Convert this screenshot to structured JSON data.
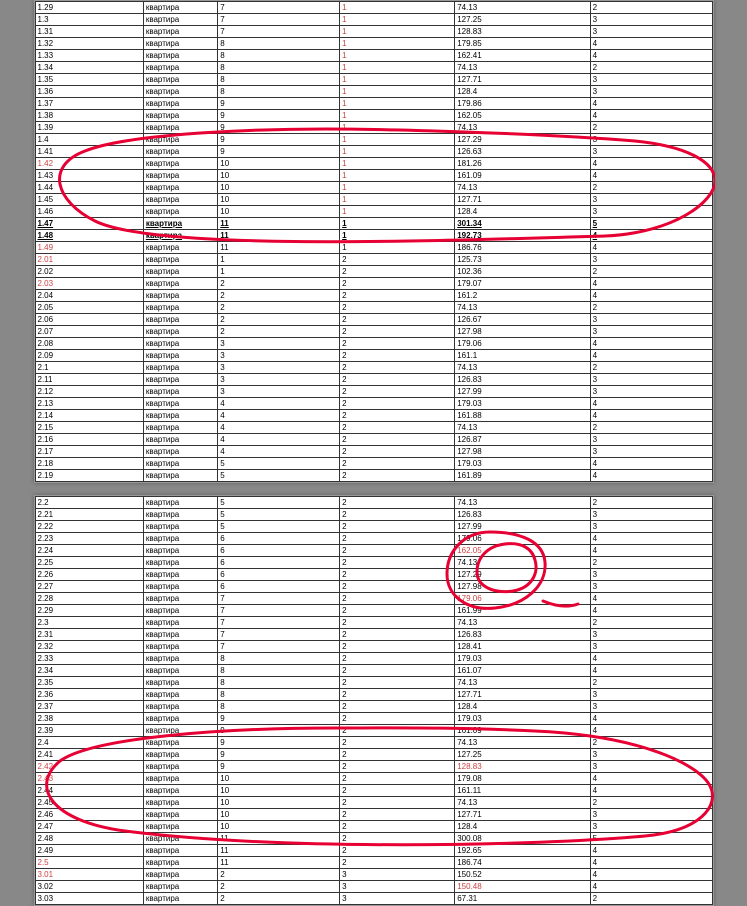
{
  "table1": {
    "rows": [
      {
        "id": "1.29",
        "type": "квартира",
        "a": "7",
        "b": "1",
        "area": "74.13",
        "r": "2",
        "bold": false,
        "bRed": true
      },
      {
        "id": "1.3",
        "type": "квартира",
        "a": "7",
        "b": "1",
        "area": "127.25",
        "r": "3",
        "bold": false,
        "bRed": true
      },
      {
        "id": "1.31",
        "type": "квартира",
        "a": "7",
        "b": "1",
        "area": "128.83",
        "r": "3",
        "bold": false,
        "bRed": true
      },
      {
        "id": "1.32",
        "type": "квартира",
        "a": "8",
        "b": "1",
        "area": "179.85",
        "r": "4",
        "bold": false,
        "bRed": true
      },
      {
        "id": "1.33",
        "type": "квартира",
        "a": "8",
        "b": "1",
        "area": "162.41",
        "r": "4",
        "bold": false,
        "bRed": true
      },
      {
        "id": "1.34",
        "type": "квартира",
        "a": "8",
        "b": "1",
        "area": "74.13",
        "r": "2",
        "bold": false,
        "bRed": true
      },
      {
        "id": "1.35",
        "type": "квартира",
        "a": "8",
        "b": "1",
        "area": "127.71",
        "r": "3",
        "bold": false,
        "bRed": true
      },
      {
        "id": "1.36",
        "type": "квартира",
        "a": "8",
        "b": "1",
        "area": "128.4",
        "r": "3",
        "bold": false,
        "bRed": true
      },
      {
        "id": "1.37",
        "type": "квартира",
        "a": "9",
        "b": "1",
        "area": "179.86",
        "r": "4",
        "bold": false,
        "bRed": true
      },
      {
        "id": "1.38",
        "type": "квартира",
        "a": "9",
        "b": "1",
        "area": "162.05",
        "r": "4",
        "bold": false,
        "bRed": true
      },
      {
        "id": "1.39",
        "type": "квартира",
        "a": "9",
        "b": "1",
        "area": "74.13",
        "r": "2",
        "bold": false,
        "bRed": true
      },
      {
        "id": "1.4",
        "type": "квартира",
        "a": "9",
        "b": "1",
        "area": "127.29",
        "r": "3",
        "bold": false,
        "bRed": true
      },
      {
        "id": "1.41",
        "type": "квартира",
        "a": "9",
        "b": "1",
        "area": "126.63",
        "r": "3",
        "bold": false,
        "bRed": true
      },
      {
        "id": "1.42",
        "type": "квартира",
        "a": "10",
        "b": "1",
        "area": "181.26",
        "r": "4",
        "bold": false,
        "bRed": true,
        "idRed": true
      },
      {
        "id": "1.43",
        "type": "квартира",
        "a": "10",
        "b": "1",
        "area": "161.09",
        "r": "4",
        "bold": false,
        "bRed": true
      },
      {
        "id": "1.44",
        "type": "квартира",
        "a": "10",
        "b": "1",
        "area": "74.13",
        "r": "2",
        "bold": false,
        "bRed": true
      },
      {
        "id": "1.45",
        "type": "квартира",
        "a": "10",
        "b": "1",
        "area": "127.71",
        "r": "3",
        "bold": false,
        "bRed": true
      },
      {
        "id": "1.46",
        "type": "квартира",
        "a": "10",
        "b": "1",
        "area": "128.4",
        "r": "3",
        "bold": false,
        "bRed": true
      },
      {
        "id": "1.47",
        "type": "квартира",
        "a": "11",
        "b": "1",
        "area": "301.34",
        "r": "5",
        "bold": true,
        "bRed": false
      },
      {
        "id": "1.48",
        "type": "квартира",
        "a": "11",
        "b": "1",
        "area": "192.73",
        "r": "4",
        "bold": true,
        "bRed": false
      },
      {
        "id": "1.49",
        "type": "квартира",
        "a": "11",
        "b": "1",
        "area": "186.76",
        "r": "4",
        "bold": false,
        "bRed": false,
        "idRed": true
      },
      {
        "id": "2.01",
        "type": "квартира",
        "a": "1",
        "b": "2",
        "area": "125.73",
        "r": "3",
        "bold": false,
        "bRed": false,
        "idRed": true
      },
      {
        "id": "2.02",
        "type": "квартира",
        "a": "1",
        "b": "2",
        "area": "102.36",
        "r": "2",
        "bold": false,
        "bRed": false
      },
      {
        "id": "2.03",
        "type": "квартира",
        "a": "2",
        "b": "2",
        "area": "179.07",
        "r": "4",
        "bold": false,
        "bRed": false,
        "idRed": true
      },
      {
        "id": "2.04",
        "type": "квартира",
        "a": "2",
        "b": "2",
        "area": "161.2",
        "r": "4",
        "bold": false,
        "bRed": false
      },
      {
        "id": "2.05",
        "type": "квартира",
        "a": "2",
        "b": "2",
        "area": "74.13",
        "r": "2",
        "bold": false,
        "bRed": false
      },
      {
        "id": "2.06",
        "type": "квартира",
        "a": "2",
        "b": "2",
        "area": "126.67",
        "r": "3",
        "bold": false,
        "bRed": false
      },
      {
        "id": "2.07",
        "type": "квартира",
        "a": "2",
        "b": "2",
        "area": "127.98",
        "r": "3",
        "bold": false,
        "bRed": false
      },
      {
        "id": "2.08",
        "type": "квартира",
        "a": "3",
        "b": "2",
        "area": "179.06",
        "r": "4",
        "bold": false,
        "bRed": false
      },
      {
        "id": "2.09",
        "type": "квартира",
        "a": "3",
        "b": "2",
        "area": "161.1",
        "r": "4",
        "bold": false,
        "bRed": false
      },
      {
        "id": "2.1",
        "type": "квартира",
        "a": "3",
        "b": "2",
        "area": "74.13",
        "r": "2",
        "bold": false,
        "bRed": false
      },
      {
        "id": "2.11",
        "type": "квартира",
        "a": "3",
        "b": "2",
        "area": "126.83",
        "r": "3",
        "bold": false,
        "bRed": false
      },
      {
        "id": "2.12",
        "type": "квартира",
        "a": "3",
        "b": "2",
        "area": "127.99",
        "r": "3",
        "bold": false,
        "bRed": false
      },
      {
        "id": "2.13",
        "type": "квартира",
        "a": "4",
        "b": "2",
        "area": "179.03",
        "r": "4",
        "bold": false,
        "bRed": false
      },
      {
        "id": "2.14",
        "type": "квартира",
        "a": "4",
        "b": "2",
        "area": "161.88",
        "r": "4",
        "bold": false,
        "bRed": false
      },
      {
        "id": "2.15",
        "type": "квартира",
        "a": "4",
        "b": "2",
        "area": "74.13",
        "r": "2",
        "bold": false,
        "bRed": false
      },
      {
        "id": "2.16",
        "type": "квартира",
        "a": "4",
        "b": "2",
        "area": "126.87",
        "r": "3",
        "bold": false,
        "bRed": false
      },
      {
        "id": "2.17",
        "type": "квартира",
        "a": "4",
        "b": "2",
        "area": "127.98",
        "r": "3",
        "bold": false,
        "bRed": false
      },
      {
        "id": "2.18",
        "type": "квартира",
        "a": "5",
        "b": "2",
        "area": "179.03",
        "r": "4",
        "bold": false,
        "bRed": false
      },
      {
        "id": "2.19",
        "type": "квартира",
        "a": "5",
        "b": "2",
        "area": "161.89",
        "r": "4",
        "bold": false,
        "bRed": false
      }
    ]
  },
  "table2": {
    "rows": [
      {
        "id": "2.2",
        "type": "квартира",
        "a": "5",
        "b": "2",
        "area": "74.13",
        "r": "2",
        "bold": false,
        "bRed": false
      },
      {
        "id": "2.21",
        "type": "квартира",
        "a": "5",
        "b": "2",
        "area": "126.83",
        "r": "3",
        "bold": false,
        "bRed": false
      },
      {
        "id": "2.22",
        "type": "квартира",
        "a": "5",
        "b": "2",
        "area": "127.99",
        "r": "3",
        "bold": false,
        "bRed": false
      },
      {
        "id": "2.23",
        "type": "квартира",
        "a": "6",
        "b": "2",
        "area": "179.06",
        "r": "4",
        "bold": false,
        "bRed": false
      },
      {
        "id": "2.24",
        "type": "квартира",
        "a": "6",
        "b": "2",
        "area": "162.05",
        "r": "4",
        "bold": false,
        "bRed": false,
        "areaRed": true
      },
      {
        "id": "2.25",
        "type": "квартира",
        "a": "6",
        "b": "2",
        "area": "74.13",
        "r": "2",
        "bold": false,
        "bRed": false
      },
      {
        "id": "2.26",
        "type": "квартира",
        "a": "6",
        "b": "2",
        "area": "127.29",
        "r": "3",
        "bold": false,
        "bRed": false
      },
      {
        "id": "2.27",
        "type": "квартира",
        "a": "6",
        "b": "2",
        "area": "127.98",
        "r": "3",
        "bold": false,
        "bRed": false
      },
      {
        "id": "2.28",
        "type": "квартира",
        "a": "7",
        "b": "2",
        "area": "179.06",
        "r": "4",
        "bold": false,
        "bRed": false,
        "areaRed": true
      },
      {
        "id": "2.29",
        "type": "квартира",
        "a": "7",
        "b": "2",
        "area": "161.99",
        "r": "4",
        "bold": false,
        "bRed": false
      },
      {
        "id": "2.3",
        "type": "квартира",
        "a": "7",
        "b": "2",
        "area": "74.13",
        "r": "2",
        "bold": false,
        "bRed": false
      },
      {
        "id": "2.31",
        "type": "квартира",
        "a": "7",
        "b": "2",
        "area": "126.83",
        "r": "3",
        "bold": false,
        "bRed": false
      },
      {
        "id": "2.32",
        "type": "квартира",
        "a": "7",
        "b": "2",
        "area": "128.41",
        "r": "3",
        "bold": false,
        "bRed": false
      },
      {
        "id": "2.33",
        "type": "квартира",
        "a": "8",
        "b": "2",
        "area": "179.03",
        "r": "4",
        "bold": false,
        "bRed": false
      },
      {
        "id": "2.34",
        "type": "квартира",
        "a": "8",
        "b": "2",
        "area": "161.07",
        "r": "4",
        "bold": false,
        "bRed": false
      },
      {
        "id": "2.35",
        "type": "квартира",
        "a": "8",
        "b": "2",
        "area": "74.13",
        "r": "2",
        "bold": false,
        "bRed": false
      },
      {
        "id": "2.36",
        "type": "квартира",
        "a": "8",
        "b": "2",
        "area": "127.71",
        "r": "3",
        "bold": false,
        "bRed": false
      },
      {
        "id": "2.37",
        "type": "квартира",
        "a": "8",
        "b": "2",
        "area": "128.4",
        "r": "3",
        "bold": false,
        "bRed": false
      },
      {
        "id": "2.38",
        "type": "квартира",
        "a": "9",
        "b": "2",
        "area": "179.03",
        "r": "4",
        "bold": false,
        "bRed": false
      },
      {
        "id": "2.39",
        "type": "квартира",
        "a": "9",
        "b": "2",
        "area": "161.09",
        "r": "4",
        "bold": false,
        "bRed": false
      },
      {
        "id": "2.4",
        "type": "квартира",
        "a": "9",
        "b": "2",
        "area": "74.13",
        "r": "2",
        "bold": false,
        "bRed": false
      },
      {
        "id": "2.41",
        "type": "квартира",
        "a": "9",
        "b": "2",
        "area": "127.25",
        "r": "3",
        "bold": false,
        "bRed": false
      },
      {
        "id": "2.42",
        "type": "квартира",
        "a": "9",
        "b": "2",
        "area": "128.83",
        "r": "3",
        "bold": false,
        "bRed": false,
        "idRed": true,
        "areaRed": true
      },
      {
        "id": "2.43",
        "type": "квартира",
        "a": "10",
        "b": "2",
        "area": "179.08",
        "r": "4",
        "bold": false,
        "bRed": false,
        "idRed": true
      },
      {
        "id": "2.44",
        "type": "квартира",
        "a": "10",
        "b": "2",
        "area": "161.11",
        "r": "4",
        "bold": false,
        "bRed": false
      },
      {
        "id": "2.45",
        "type": "квартира",
        "a": "10",
        "b": "2",
        "area": "74.13",
        "r": "2",
        "bold": false,
        "bRed": false
      },
      {
        "id": "2.46",
        "type": "квартира",
        "a": "10",
        "b": "2",
        "area": "127.71",
        "r": "3",
        "bold": false,
        "bRed": false
      },
      {
        "id": "2.47",
        "type": "квартира",
        "a": "10",
        "b": "2",
        "area": "128.4",
        "r": "3",
        "bold": false,
        "bRed": false
      },
      {
        "id": "2.48",
        "type": "квартира",
        "a": "11",
        "b": "2",
        "area": "300.08",
        "r": "5",
        "bold": false,
        "bRed": false
      },
      {
        "id": "2.49",
        "type": "квартира",
        "a": "11",
        "b": "2",
        "area": "192.65",
        "r": "4",
        "bold": false,
        "bRed": false
      },
      {
        "id": "2.5",
        "type": "квартира",
        "a": "11",
        "b": "2",
        "area": "186.74",
        "r": "4",
        "bold": false,
        "bRed": false,
        "idRed": true
      },
      {
        "id": "3.01",
        "type": "квартира",
        "a": "2",
        "b": "3",
        "area": "150.52",
        "r": "4",
        "bold": false,
        "bRed": false,
        "idRed": true
      },
      {
        "id": "3.02",
        "type": "квартира",
        "a": "2",
        "b": "3",
        "area": "150.48",
        "r": "4",
        "bold": false,
        "bRed": false,
        "areaRed": true
      },
      {
        "id": "3.03",
        "type": "квартира",
        "a": "2",
        "b": "3",
        "area": "67.31",
        "r": "2",
        "bold": false,
        "bRed": false
      }
    ]
  }
}
